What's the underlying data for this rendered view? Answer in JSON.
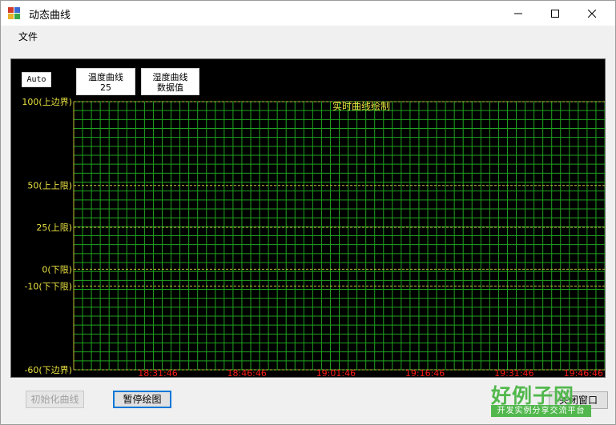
{
  "window": {
    "title": "动态曲线"
  },
  "menu": {
    "file": "文件"
  },
  "controls": {
    "auto": "Auto",
    "temp_line1": "温度曲线",
    "temp_line2": "25",
    "humid_line1": "湿度曲线",
    "humid_line2": "数据值"
  },
  "chart_data": {
    "type": "line",
    "title": "实时曲线绘制",
    "ylim": [
      -60,
      100
    ],
    "y_ticks": [
      {
        "value": 100,
        "label": "100(上边界)"
      },
      {
        "value": 50,
        "label": "50(上上限)"
      },
      {
        "value": 25,
        "label": "25(上限)"
      },
      {
        "value": 0,
        "label": "0(下限)"
      },
      {
        "value": -10,
        "label": "-10(下下限)"
      },
      {
        "value": -60,
        "label": "-60(下边界)"
      }
    ],
    "x_ticks": [
      "18:31:46",
      "18:46:46",
      "19:01:46",
      "19:16:46",
      "19:31:46",
      "19:46:46"
    ],
    "series": [],
    "grid": true,
    "colors": {
      "grid": "#1fa31f",
      "limit": "#c7c23a",
      "axis_text": "#e8e040",
      "time_text": "#ff1a1a",
      "background": "#000000"
    }
  },
  "buttons": {
    "init": "初始化曲线",
    "pause": "暂停绘图",
    "close": "关闭窗口"
  },
  "watermark": {
    "big": "好例子网",
    "small": "开发实例分享交流平台"
  },
  "background_edge": [
    "e",
    "b",
    "nc"
  ]
}
